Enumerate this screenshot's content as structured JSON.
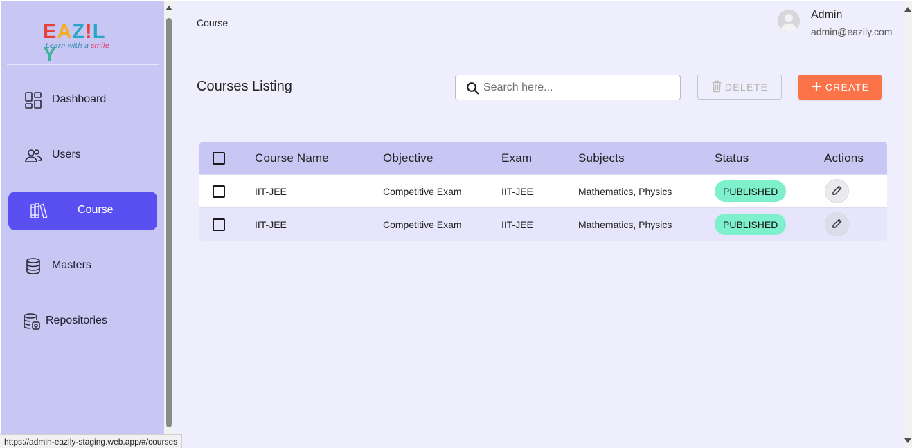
{
  "logo": {
    "letters": [
      "E",
      "A",
      "Z",
      "!",
      "L",
      "Y"
    ],
    "colors": [
      "#e8413a",
      "#f2b02a",
      "#2aa6c9",
      "#e8413a",
      "#2aa6c9",
      "#3bb39a"
    ],
    "tagline_prefix": "Learn with a ",
    "tagline_smile": "smile"
  },
  "sidebar": {
    "items": [
      {
        "label": "Dashboard",
        "icon": "dashboard-icon"
      },
      {
        "label": "Users",
        "icon": "users-icon"
      },
      {
        "label": "Course",
        "icon": "books-icon",
        "active": true
      },
      {
        "label": "Masters",
        "icon": "database-icon"
      },
      {
        "label": "Repositories",
        "icon": "repository-icon"
      }
    ]
  },
  "header": {
    "breadcrumb": "Course",
    "user_name": "Admin",
    "user_email": "admin@eazily.com"
  },
  "main": {
    "title": "Courses Listing",
    "search_placeholder": "Search here...",
    "delete_label": "DELETE",
    "create_label": "CREATE"
  },
  "table": {
    "headers": {
      "course_name": "Course Name",
      "objective": "Objective",
      "exam": "Exam",
      "subjects": "Subjects",
      "status": "Status",
      "actions": "Actions"
    },
    "rows": [
      {
        "course_name": "IIT-JEE",
        "objective": "Competitive Exam",
        "exam": "IIT-JEE",
        "subjects": "Mathematics, Physics",
        "status": "PUBLISHED"
      },
      {
        "course_name": "IIT-JEE",
        "objective": "Competitive Exam",
        "exam": "IIT-JEE",
        "subjects": "Mathematics, Physics",
        "status": "PUBLISHED"
      }
    ]
  },
  "statusbar": {
    "url": "https://admin-eazily-staging.web.app/#/courses"
  },
  "colors": {
    "sidebar_bg": "#c8c6f3",
    "active_nav": "#5a50f2",
    "create_button": "#fb7348",
    "published_badge": "#7ef0cc",
    "main_bg": "#efeefc"
  }
}
